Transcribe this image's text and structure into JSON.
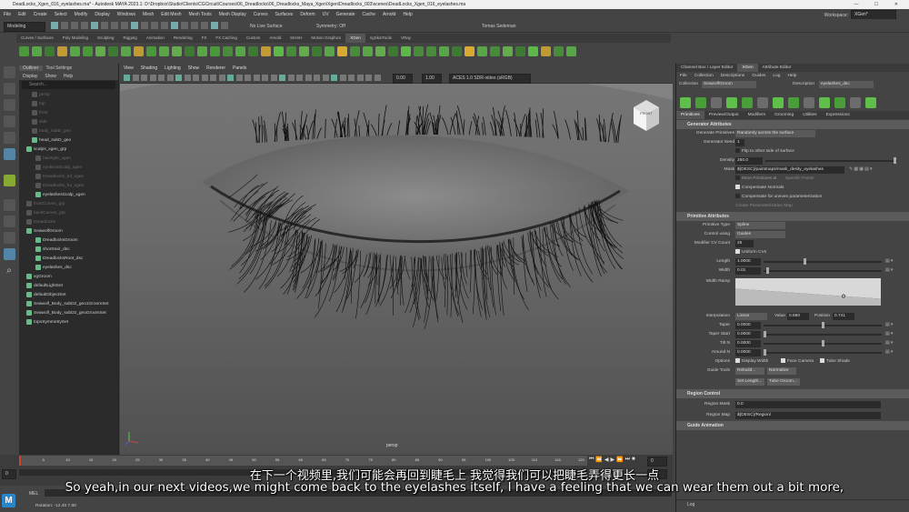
{
  "title": "DeadLocks_Xgen_016_eyelashes.ma* - Autodesk MAYA 2023.1: D:\\Dropbox\\Studio\\Clients\\CGCircuit\\Courses\\06_Dreadlocks\\06_Dreadlocks_Maya_Xgen\\Xgen\\Dreadlocks_003\\scenes\\DeadLocks_Xgen_016_eyelashes.ma",
  "menu": [
    "File",
    "Edit",
    "Create",
    "Select",
    "Modify",
    "Display",
    "Windows",
    "Mesh",
    "Edit Mesh",
    "Mesh Tools",
    "Mesh Display",
    "Curves",
    "Surfaces",
    "Deform",
    "UV",
    "Generate",
    "Cache",
    "Arnold",
    "Help"
  ],
  "workspace_label": "Workspace:",
  "workspace_value": "XGen*",
  "mode": "Modeling",
  "live_surface": "No Live Surface",
  "symmetry": "Symmetry: Off",
  "user": "Tomas Sedeman",
  "shelf_tabs": [
    "Curves / Surfaces",
    "Poly Modeling",
    "Sculpting",
    "Rigging",
    "Animation",
    "Rendering",
    "FX",
    "FX Caching",
    "Custom",
    "Arnold",
    "MASH",
    "Motion Graphics",
    "XGen",
    "ngSkinTools",
    "VRay"
  ],
  "outliner": {
    "tabs": [
      "Outliner",
      "Tool Settings"
    ],
    "menu": [
      "Display",
      "Show",
      "Help"
    ],
    "search": "Search...",
    "items": [
      {
        "label": "persp",
        "dim": true,
        "indent": 14
      },
      {
        "label": "top",
        "dim": true,
        "indent": 14
      },
      {
        "label": "front",
        "dim": true,
        "indent": 14
      },
      {
        "label": "side",
        "dim": true,
        "indent": 14
      },
      {
        "label": "body_subD_geo",
        "dim": true,
        "indent": 14
      },
      {
        "label": "head_subD_geo",
        "dim": false,
        "indent": 14
      },
      {
        "label": "scalps_xgen_grp",
        "dim": false,
        "indent": 8
      },
      {
        "label": "hairstyle_xgen",
        "dim": true,
        "indent": 18
      },
      {
        "label": "eyebrowScalp_xgen",
        "dim": true,
        "indent": 18
      },
      {
        "label": "Dreadlocks_bd_xgen",
        "dim": true,
        "indent": 18
      },
      {
        "label": "Dreadlocks_fur_xgen",
        "dim": true,
        "indent": 18
      },
      {
        "label": "eyelashesScalp_xgen",
        "dim": false,
        "indent": 18
      },
      {
        "label": "frontCurves_grp",
        "dim": true,
        "indent": 8
      },
      {
        "label": "backCurves_grp",
        "dim": true,
        "indent": 8
      },
      {
        "label": "Dreadlocks",
        "dim": true,
        "indent": 8
      },
      {
        "label": "SeawolfGroom",
        "dim": false,
        "indent": 8
      },
      {
        "label": "DreadlocksGroom",
        "dim": false,
        "indent": 18
      },
      {
        "label": "shortHair_dsc",
        "dim": false,
        "indent": 18
      },
      {
        "label": "DreadlocksRoot_dsc",
        "dim": false,
        "indent": 18
      },
      {
        "label": "eyelashes_dsc",
        "dim": false,
        "indent": 18
      },
      {
        "label": "xgGroom",
        "dim": false,
        "indent": 8
      },
      {
        "label": "defaultLightSet",
        "dim": false,
        "indent": 8
      },
      {
        "label": "defaultObjectSet",
        "dim": false,
        "indent": 8
      },
      {
        "label": "Seawolf_Body_subD2_geo1GroomSet",
        "dim": false,
        "indent": 8
      },
      {
        "label": "Seawolf_Body_subD2_geoGroomSet",
        "dim": false,
        "indent": 8
      },
      {
        "label": "topoSymmetrySet",
        "dim": false,
        "indent": 8
      }
    ]
  },
  "viewport": {
    "menu": [
      "View",
      "Shading",
      "Lighting",
      "Show",
      "Renderer",
      "Panels"
    ],
    "exposure": "0.00",
    "gamma": "1.00",
    "colorspace": "ACES 1.0 SDR-video (sRGB)",
    "camera": "persp",
    "cube_label": "FRONT"
  },
  "timeline": {
    "start": "0",
    "current": "0",
    "end": "120",
    "ticks": [
      "5",
      "10",
      "15",
      "20",
      "25",
      "30",
      "35",
      "40",
      "45",
      "50",
      "55",
      "60",
      "65",
      "70",
      "75",
      "80",
      "85",
      "90",
      "95",
      "100",
      "105",
      "110",
      "115",
      "120"
    ]
  },
  "cmd": {
    "label": "MEL",
    "rotation": "Rotation:   -12.40     7.80"
  },
  "right_panel": {
    "tabs": [
      "Channel Box / Layer Editor",
      "XGen",
      "Attribute Editor"
    ],
    "menu": [
      "File",
      "Collection",
      "Descriptions",
      "Guides",
      "Log",
      "Help"
    ],
    "collection_label": "Collection",
    "collection": "SeawolfGroom",
    "description_label": "Description",
    "description": "eyelashes_dsc",
    "subtabs": [
      "Primitives",
      "Preview/Output",
      "Modifiers",
      "Grooming",
      "Utilities",
      "Expressions"
    ],
    "generator": {
      "title": "Generator Attributes",
      "primitives_label": "Generate Primitives",
      "primitives": "Randomly across the surface",
      "seed_label": "Generator Seed",
      "seed": "1",
      "flip_label": "Flip to other side of surface",
      "density_label": "Density",
      "density": "250.0",
      "density_frac": 0.99,
      "mask_label": "Mask",
      "mask": "${DESC}/paintmaps/mask_desity_eyelashes",
      "more_label": "More Primitives at",
      "specific_points": "Specific Points",
      "comp_label": "Compensate Normals",
      "uneven_label": "Compensate for uneven parameterization",
      "create_param": "Create Parameterization Map"
    },
    "primitive": {
      "title": "Primitive Attributes",
      "type_label": "Primitive Type",
      "type": "Spline",
      "ctrl_label": "Control using",
      "ctrl": "Guides",
      "cv_label": "Modifier CV Count",
      "cv": "25",
      "uniform_label": "Uniform CVs",
      "length_label": "Length",
      "length": "1.0000",
      "length_frac": 0.35,
      "width_label": "Width",
      "width": "0.01",
      "width_frac": 0.02,
      "ramp_label": "Width Ramp",
      "ramp_start": 0.62,
      "ramp_end": 0.25,
      "ramp_point": 0.59,
      "interp_label": "Interpolation",
      "interp": "Linear",
      "value_label": "Value",
      "value": "0.590",
      "position_label": "Position",
      "position": "0.741",
      "taper_label": "Taper",
      "taper": "0.0000",
      "taper_frac": 0.5,
      "tstart_label": "Taper Start",
      "tstart": "0.0000",
      "tstart_frac": 0.0,
      "tiltn_label": "Tilt N",
      "tiltn": "0.0000",
      "tiltn_frac": 0.5,
      "aroundn_label": "Around N",
      "aroundn": "0.0000",
      "aroundn_frac": 0.0,
      "options_label": "Options",
      "opt_display": "Display Width",
      "opt_face": "Face Camera",
      "opt_tube": "Tube Shade",
      "guide_label": "Guide Tools",
      "rebuild": "Rebuild...",
      "normalize": "Normalize",
      "setlength": "Set Length...",
      "tubegroom": "Tube Groom..."
    },
    "region": {
      "title": "Region Control",
      "mask_label": "Region Mask",
      "mask": "0.0",
      "map_label": "Region Map",
      "map": "${DESC}/Region/"
    },
    "guide_anim": "Guide Animation",
    "log": "Log"
  },
  "subtitles": {
    "zh": "在下一个视频里,我们可能会再回到睫毛上 我觉得我们可以把睫毛弄得更长一点",
    "en": "So yeah,in our next videos,we might come back to the eyelashes itself, I have a feeling that we can wear them out a bit more,"
  },
  "colors": {
    "xgen_green": "#5fbf4a",
    "timeline_red": "#c43",
    "highlight": "#5285a6"
  }
}
